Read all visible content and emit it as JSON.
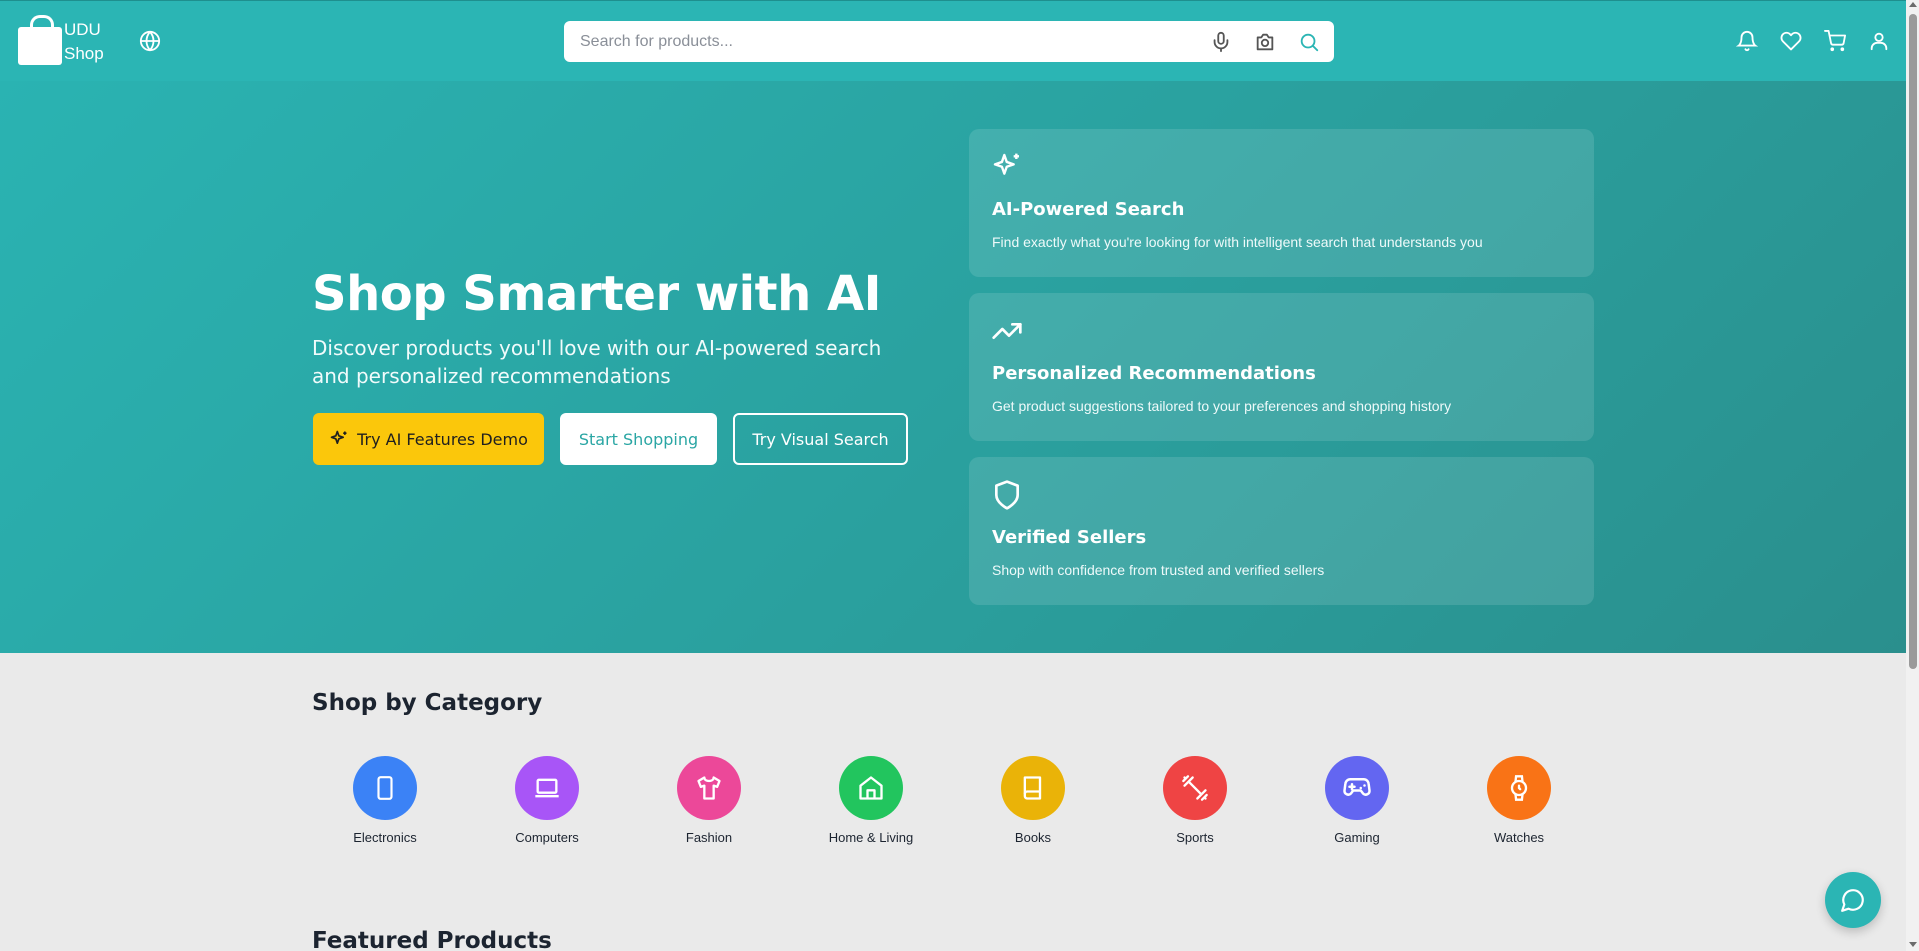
{
  "header": {
    "logo_line1": "UDU",
    "logo_line2": "Shop",
    "search_placeholder": "Search for products...",
    "icons": [
      "globe-icon",
      "microphone-icon",
      "camera-icon",
      "search-icon",
      "bell-icon",
      "heart-icon",
      "cart-icon",
      "user-icon"
    ]
  },
  "hero": {
    "title": "Shop Smarter with AI",
    "subtitle": "Discover products you'll love with our AI-powered search and personalized recommendations",
    "buttons": {
      "ai_demo": "Try AI Features Demo",
      "start_shopping": "Start Shopping",
      "visual_search": "Try Visual Search"
    },
    "features": [
      {
        "icon": "sparkles-icon",
        "title": "AI-Powered Search",
        "desc": "Find exactly what you're looking for with intelligent search that understands you"
      },
      {
        "icon": "trending-up-icon",
        "title": "Personalized Recommendations",
        "desc": "Get product suggestions tailored to your preferences and shopping history"
      },
      {
        "icon": "shield-icon",
        "title": "Verified Sellers",
        "desc": "Shop with confidence from trusted and verified sellers"
      }
    ]
  },
  "categories": {
    "title": "Shop by Category",
    "items": [
      {
        "label": "Electronics",
        "color": "#3b82f6",
        "icon": "smartphone-icon"
      },
      {
        "label": "Computers",
        "color": "#a855f7",
        "icon": "laptop-icon"
      },
      {
        "label": "Fashion",
        "color": "#ec4899",
        "icon": "shirt-icon"
      },
      {
        "label": "Home & Living",
        "color": "#22c55e",
        "icon": "home-icon"
      },
      {
        "label": "Books",
        "color": "#eab308",
        "icon": "book-icon"
      },
      {
        "label": "Sports",
        "color": "#ef4444",
        "icon": "dumbbell-icon"
      },
      {
        "label": "Gaming",
        "color": "#6366f1",
        "icon": "gamepad-icon"
      },
      {
        "label": "Watches",
        "color": "#f97316",
        "icon": "watch-icon"
      }
    ]
  },
  "featured": {
    "title": "Featured Products"
  },
  "colors": {
    "brand": "#2bb5b4",
    "accent": "#fbc70b"
  }
}
